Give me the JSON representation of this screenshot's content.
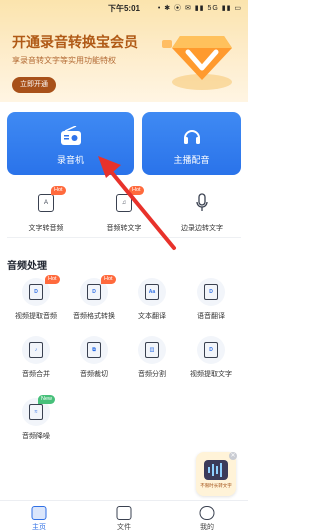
{
  "status_bar": {
    "time": "下午5:01",
    "icons": "• ✱ ⦿ ✉ ▮▮ 5G ▮▮ ▭"
  },
  "vip": {
    "title": "开通录音转换宝会员",
    "subtitle": "享录音转文字等实用功能特权",
    "button": "立即开通"
  },
  "cards": {
    "recorder": "录音机",
    "anchor_voice": "主播配音"
  },
  "tools": [
    {
      "label": "文字转音频",
      "badge": "Hot",
      "icon": "A"
    },
    {
      "label": "音频转文字",
      "badge": "Hot",
      "icon": "♫"
    },
    {
      "label": "边录边转文字",
      "badge": "",
      "icon": "mic"
    }
  ],
  "section_title": "音频处理",
  "audio_tools": [
    {
      "label": "视频提取音频",
      "badge": "Hot",
      "icon": "D"
    },
    {
      "label": "音频格式转换",
      "badge": "Hot",
      "icon": "D"
    },
    {
      "label": "文本翻译",
      "badge": "",
      "icon": "Aa"
    },
    {
      "label": "语音翻译",
      "badge": "",
      "icon": "D"
    },
    {
      "label": "音频合并",
      "badge": "",
      "icon": "♪"
    },
    {
      "label": "音频裁切",
      "badge": "",
      "icon": "⧉"
    },
    {
      "label": "音频分割",
      "badge": "",
      "icon": "◫"
    },
    {
      "label": "视频提取文字",
      "badge": "",
      "icon": "D"
    },
    {
      "label": "音频降噪",
      "badge": "New",
      "icon": "≈"
    }
  ],
  "float_ad": {
    "text": "不限时长转文字"
  },
  "tabbar": [
    {
      "label": "主页",
      "active": true
    },
    {
      "label": "文件",
      "active": false
    },
    {
      "label": "我的",
      "active": false
    }
  ],
  "colors": {
    "accent": "#2f6fe4",
    "vip_brown": "#a8511a",
    "hot": "#ff6a3d",
    "new": "#47c07a",
    "arrow": "#e8322b"
  }
}
